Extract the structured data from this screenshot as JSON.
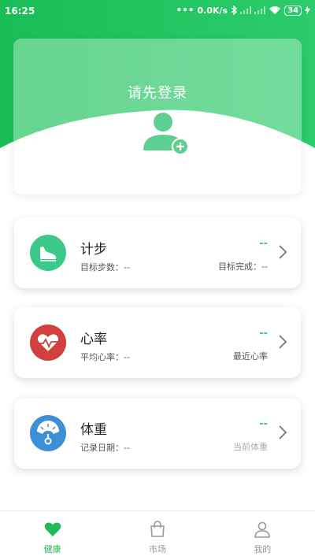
{
  "status_bar": {
    "time": "16:25",
    "network_speed": "0.0K/s",
    "battery": "34",
    "icons": [
      "dots-icon",
      "bluetooth-icon",
      "signal-icon",
      "signal-icon",
      "wifi-icon",
      "battery-icon",
      "charging-icon"
    ]
  },
  "colors": {
    "header_green": "#1ec05c",
    "accent_green": "#3ec77e",
    "steps_icon_bg": "#3bc98a",
    "heart_icon_bg": "#d0403e",
    "weight_icon_bg": "#3d8fd6",
    "tab_active": "#23b957",
    "tab_inactive": "#999999"
  },
  "login": {
    "title": "请先登录",
    "icon": "add-user-icon"
  },
  "cards": [
    {
      "id": "steps",
      "icon": "shoe-icon",
      "title": "计步",
      "sub": "目标步数：--",
      "value": "--",
      "right_label": "目标完成：--"
    },
    {
      "id": "heart-rate",
      "icon": "heart-pulse-icon",
      "title": "心率",
      "sub": "平均心率：--",
      "value": "--",
      "right_label": "最近心率"
    },
    {
      "id": "weight",
      "icon": "scale-icon",
      "title": "体重",
      "sub": "记录日期：--",
      "value": "--",
      "right_label": "当前体重"
    }
  ],
  "tabs": [
    {
      "id": "health",
      "label": "健康",
      "icon": "heart-icon",
      "active": true
    },
    {
      "id": "market",
      "label": "市场",
      "icon": "shopping-bag-icon",
      "active": false
    },
    {
      "id": "mine",
      "label": "我的",
      "icon": "person-icon",
      "active": false
    }
  ]
}
